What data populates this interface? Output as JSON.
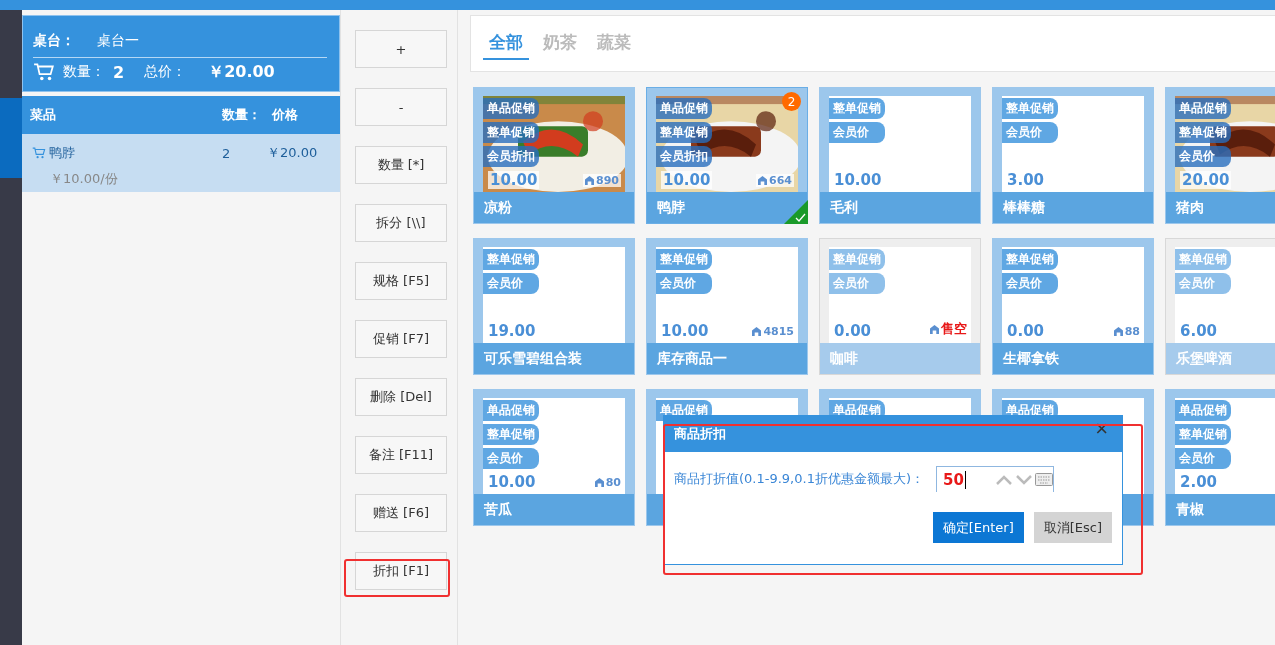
{
  "order": {
    "table_label": "桌台：",
    "table_name": "桌台一",
    "quantity_label": "数量：",
    "quantity": "2",
    "total_label": "总价：",
    "total": "￥20.00",
    "columns": [
      "菜品",
      "数量：",
      "价格"
    ],
    "rows": [
      {
        "name": "鸭脖",
        "quantity": "2",
        "price": "￥20.00",
        "unit_price": "￥10.00/份",
        "selected": true
      }
    ]
  },
  "actions": [
    {
      "label": "+",
      "highlighted": false
    },
    {
      "label": "-",
      "highlighted": false
    },
    {
      "label": "数量 [*]",
      "highlighted": false
    },
    {
      "label": "拆分 [\\\\]",
      "highlighted": false
    },
    {
      "label": "规格 [F5]",
      "highlighted": false
    },
    {
      "label": "促销 [F7]",
      "highlighted": false
    },
    {
      "label": "删除 [Del]",
      "highlighted": false
    },
    {
      "label": "备注 [F11]",
      "highlighted": false
    },
    {
      "label": "赠送 [F6]",
      "highlighted": false
    },
    {
      "label": "折扣 [F1]",
      "highlighted": true
    }
  ],
  "categories": [
    {
      "label": "全部",
      "selected": true
    },
    {
      "label": "奶茶",
      "selected": false
    },
    {
      "label": "蔬菜",
      "selected": false
    }
  ],
  "products": [
    {
      "name": "凉粉",
      "tags": [
        "单品促销",
        "整单促销",
        "会员折扣"
      ],
      "price": "10.00",
      "stock": "890",
      "picture": true,
      "selected": false,
      "dimmed": false
    },
    {
      "name": "鸭脖",
      "tags": [
        "单品促销",
        "整单促销",
        "会员折扣"
      ],
      "price": "10.00",
      "stock": "664",
      "picture": true,
      "selected": true,
      "badge": "2",
      "dimmed": false
    },
    {
      "name": "毛利",
      "tags": [
        "整单促销",
        "会员价"
      ],
      "price": "10.00",
      "picture": false,
      "selected": false,
      "dimmed": false
    },
    {
      "name": "棒棒糖",
      "tags": [
        "整单促销",
        "会员价"
      ],
      "price": "3.00",
      "picture": false,
      "selected": false,
      "dimmed": false
    },
    {
      "name": "猪肉",
      "tags": [
        "单品促销",
        "整单促销",
        "会员价"
      ],
      "price": "20.00",
      "picture": true,
      "selected": false,
      "dimmed": false
    },
    {
      "name": "可乐雪碧组合装",
      "tags": [
        "整单促销",
        "会员价"
      ],
      "price": "19.00",
      "picture": false,
      "selected": false,
      "dimmed": false
    },
    {
      "name": "库存商品一",
      "tags": [
        "整单促销",
        "会员价"
      ],
      "price": "10.00",
      "stock": "4815",
      "picture": false,
      "selected": false,
      "dimmed": false
    },
    {
      "name": "咖啡",
      "tags": [
        "整单促销",
        "会员价"
      ],
      "price": "0.00",
      "stock": "售空",
      "sold_out": true,
      "picture": false,
      "selected": false,
      "dimmed": true
    },
    {
      "name": "生椰拿铁",
      "tags": [
        "整单促销",
        "会员价"
      ],
      "price": "0.00",
      "stock": "88",
      "picture": false,
      "selected": false,
      "dimmed": false
    },
    {
      "name": "乐堡啤酒",
      "tags": [
        "整单促销",
        "会员价"
      ],
      "price": "6.00",
      "picture": false,
      "selected": false,
      "dimmed": true
    },
    {
      "name": "苦瓜",
      "tags": [
        "单品促销",
        "整单促销",
        "会员价"
      ],
      "price": "10.00",
      "stock": "80",
      "picture": false,
      "selected": false,
      "dimmed": false
    },
    {
      "tags": [
        "单品促销"
      ],
      "picture": false,
      "selected": false,
      "dimmed": false
    },
    {
      "tags": [
        "单品促销"
      ],
      "picture": false,
      "selected": false,
      "dimmed": false
    },
    {
      "tags": [
        "单品促销"
      ],
      "picture": false,
      "selected": false,
      "dimmed": false
    },
    {
      "name": "青椒",
      "tags": [
        "单品促销",
        "整单促销",
        "会员价"
      ],
      "price": "2.00",
      "picture": false,
      "selected": false,
      "dimmed": false
    }
  ],
  "dialog": {
    "title": "商品折扣",
    "close": "×",
    "label": "商品打折值(0.1-9.9,0.1折优惠金额最大)：",
    "value": "50",
    "confirm": "确定[Enter]",
    "cancel": "取消[Esc]",
    "highlighted": true
  }
}
